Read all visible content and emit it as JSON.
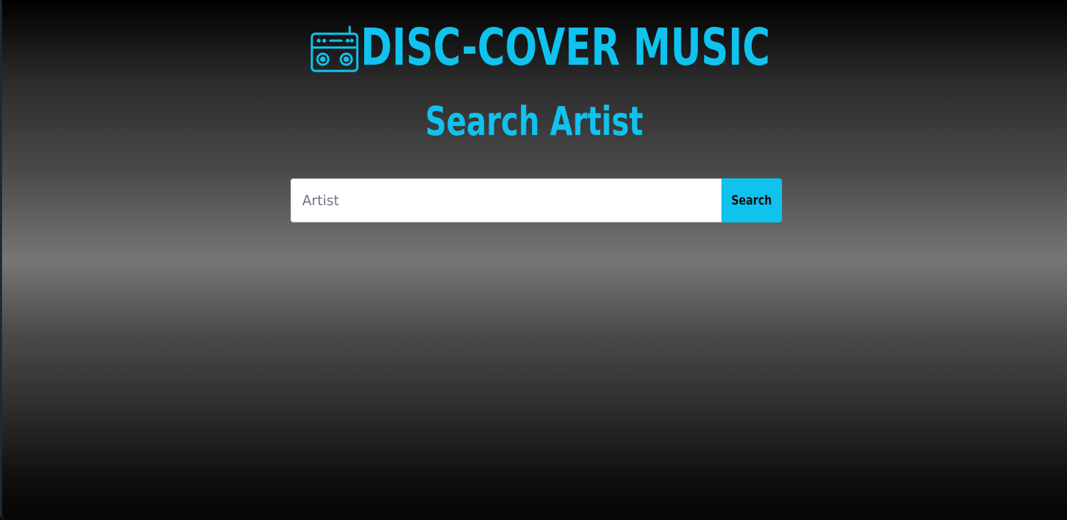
{
  "colors": {
    "accent": "#10c2ee",
    "button_text": "#111111"
  },
  "header": {
    "icon": "radio-icon",
    "title": "DISC-COVER MUSIC"
  },
  "subtitle": "Search Artist",
  "search": {
    "placeholder": "Artist",
    "value": "",
    "button_label": "Search"
  }
}
